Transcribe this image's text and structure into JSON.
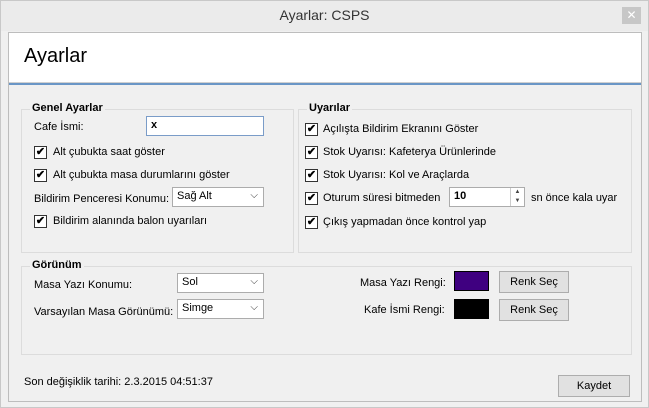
{
  "window": {
    "title": "Ayarlar: CSPS",
    "close_glyph": "✕"
  },
  "header": {
    "title": "Ayarlar"
  },
  "genel": {
    "title": "Genel Ayarlar",
    "cafe_label": "Cafe İsmi:",
    "cafe_value": "x",
    "saat_label": "Alt çubukta saat göster",
    "masa_durum_label": "Alt çubukta masa durumlarını göster",
    "bildirim_konum_label": "Bildirim Penceresi Konumu:",
    "bildirim_konum_value": "Sağ Alt",
    "balon_label": "Bildirim alanında balon uyarıları"
  },
  "uyarilar": {
    "title": "Uyarılar",
    "acilis_label": "Açılışta Bildirim Ekranını Göster",
    "stok_kafe_label": "Stok Uyarısı: Kafeterya Ürünlerinde",
    "stok_kol_label": "Stok Uyarısı: Kol ve Araçlarda",
    "oturum_label": "Oturum süresi bitmeden",
    "oturum_value": "10",
    "oturum_suffix": "sn önce kala uyar",
    "cikis_label": "Çıkış yapmadan önce kontrol yap"
  },
  "gorunum": {
    "title": "Görünüm",
    "masa_yazi_konum_label": "Masa Yazı Konumu:",
    "masa_yazi_konum_value": "Sol",
    "masa_gorunum_label": "Varsayılan Masa Görünümü:",
    "masa_gorunum_value": "Simge",
    "masa_yazi_renk_label": "Masa Yazı Rengi:",
    "masa_yazi_renk_color": "#3f0080",
    "kafe_isim_renk_label": "Kafe İsmi Rengi:",
    "kafe_isim_renk_color": "#000000",
    "renk_sec_label": "Renk Seç"
  },
  "footer": {
    "last_change": "Son değişiklik tarihi: 2.3.2015 04:51:37",
    "save_label": "Kaydet"
  },
  "icons": {
    "check": "✔",
    "caret": "⌵",
    "up": "▲",
    "down": "▼"
  }
}
